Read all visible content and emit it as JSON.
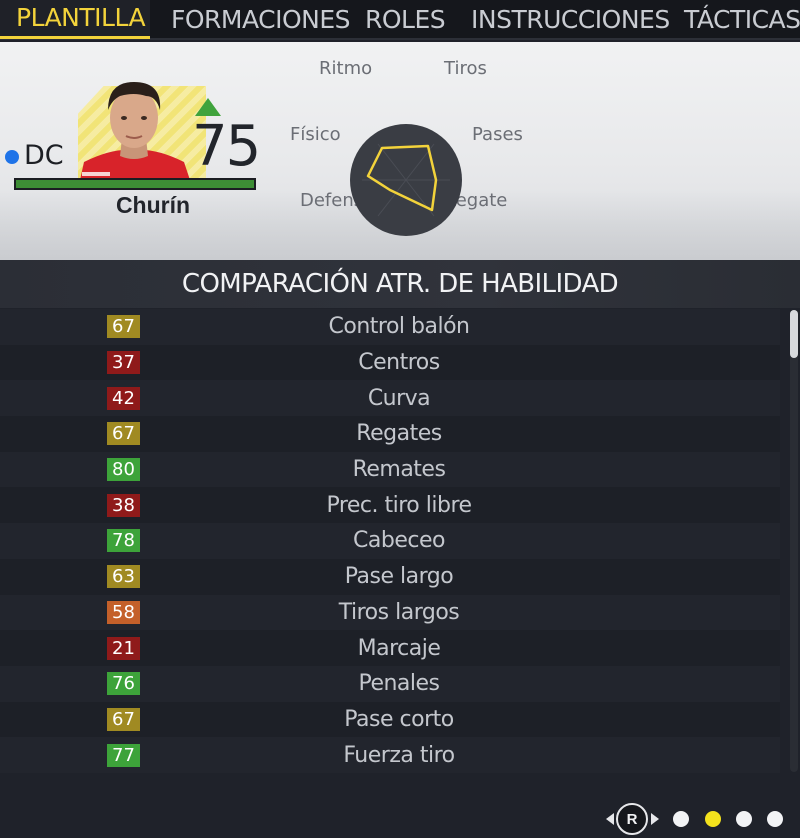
{
  "tabs": [
    {
      "label": "PLANTILLA",
      "active": true
    },
    {
      "label": "FORMACIONES",
      "active": false
    },
    {
      "label": "ROLES",
      "active": false
    },
    {
      "label": "INSTRUCCIONES",
      "active": false
    },
    {
      "label": "TÁCTICAS",
      "active": false
    }
  ],
  "player": {
    "position": "DC",
    "position_color": "#1e73e8",
    "rating": "75",
    "rating_trend": "up",
    "name": "Churín",
    "form_level": 1.0
  },
  "radar": {
    "labels": {
      "pace": "Ritmo",
      "shooting": "Tiros",
      "physical": "Físico",
      "passing": "Pases",
      "defending": "Defensa",
      "dribbling": "Regate"
    },
    "line_color": "#f3d33b"
  },
  "section": {
    "title": "COMPARACIÓN ATR. DE HABILIDAD"
  },
  "attributes": [
    {
      "name": "Control balón",
      "value": "67",
      "color": "#a08a22"
    },
    {
      "name": "Centros",
      "value": "37",
      "color": "#8f1a1a"
    },
    {
      "name": "Curva",
      "value": "42",
      "color": "#8f1a1a"
    },
    {
      "name": "Regates",
      "value": "67",
      "color": "#a08a22"
    },
    {
      "name": "Remates",
      "value": "80",
      "color": "#3da33a"
    },
    {
      "name": "Prec. tiro libre",
      "value": "38",
      "color": "#8f1a1a"
    },
    {
      "name": "Cabeceo",
      "value": "78",
      "color": "#3da33a"
    },
    {
      "name": "Pase largo",
      "value": "63",
      "color": "#a08a22"
    },
    {
      "name": "Tiros largos",
      "value": "58",
      "color": "#c4602a"
    },
    {
      "name": "Marcaje",
      "value": "21",
      "color": "#8f1a1a"
    },
    {
      "name": "Penales",
      "value": "76",
      "color": "#3da33a"
    },
    {
      "name": "Pase corto",
      "value": "67",
      "color": "#a08a22"
    },
    {
      "name": "Fuerza tiro",
      "value": "77",
      "color": "#3da33a"
    }
  ],
  "pager": {
    "button_label": "R",
    "pages": 4,
    "active_page": 2,
    "active_color": "#f3e21d"
  }
}
